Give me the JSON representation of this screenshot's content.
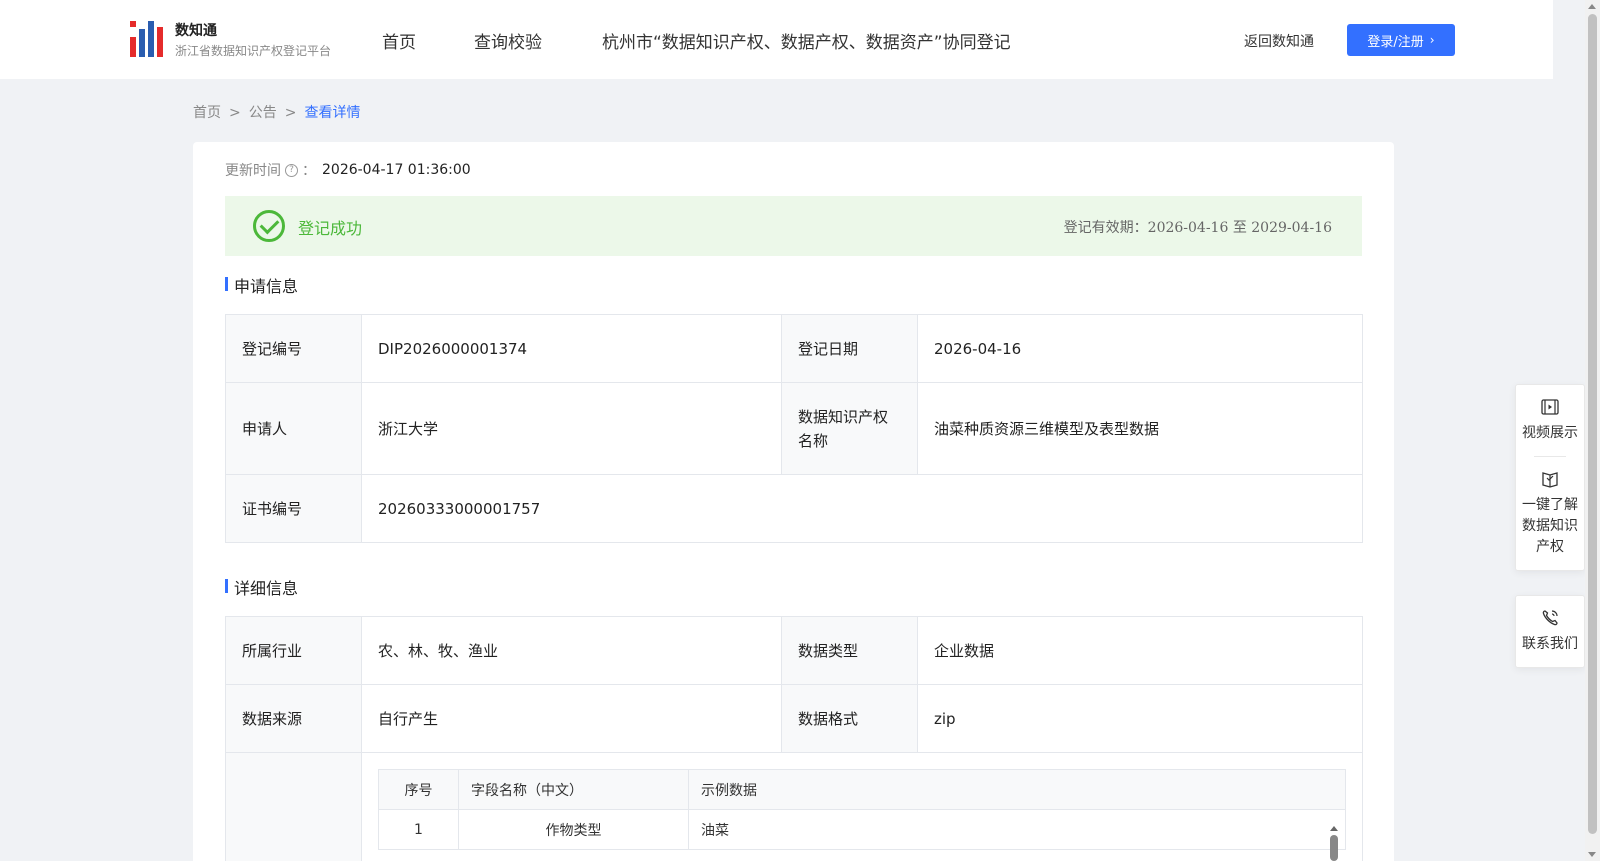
{
  "header": {
    "brand_name": "数知通",
    "brand_sub": "浙江省数据知识产权登记平台",
    "nav": [
      "首页",
      "查询校验",
      "杭州市“数据知识产权、数据产权、数据资产”协同登记"
    ],
    "back_link": "返回数知通",
    "login_label": "登录/注册",
    "accent": "#3370ff"
  },
  "breadcrumb": {
    "items": [
      "首页",
      "公告",
      "查看详情"
    ],
    "separator": ">"
  },
  "update": {
    "label": "更新时间",
    "colon": "：",
    "value": "2026-04-17 01:36:00"
  },
  "status": {
    "text": "登记成功",
    "validity": "登记有效期：2026-04-16 至 2029-04-16",
    "color": "#4cb83a"
  },
  "application": {
    "title": "申请信息",
    "reg_no_label": "登记编号",
    "reg_no": "DIP2026000001374",
    "reg_date_label": "登记日期",
    "reg_date": "2026-04-16",
    "applicant_label": "申请人",
    "applicant": "浙江大学",
    "ip_name_label": "数据知识产权名称",
    "ip_name": "油菜种质资源三维模型及表型数据",
    "cert_no_label": "证书编号",
    "cert_no": "20260333000001757"
  },
  "details": {
    "title": "详细信息",
    "industry_label": "所属行业",
    "industry": "农、林、牧、渔业",
    "data_type_label": "数据类型",
    "data_type": "企业数据",
    "source_label": "数据来源",
    "source": "自行产生",
    "format_label": "数据格式",
    "format": "zip",
    "fields": {
      "headers": [
        "序号",
        "字段名称（中文）",
        "示例数据"
      ],
      "rows": [
        {
          "no": "1",
          "name": "作物类型",
          "sample": "油菜"
        }
      ]
    }
  },
  "float_panel": {
    "video": "视频展示",
    "learn": "一键了解数据知识产权",
    "contact": "联系我们"
  }
}
